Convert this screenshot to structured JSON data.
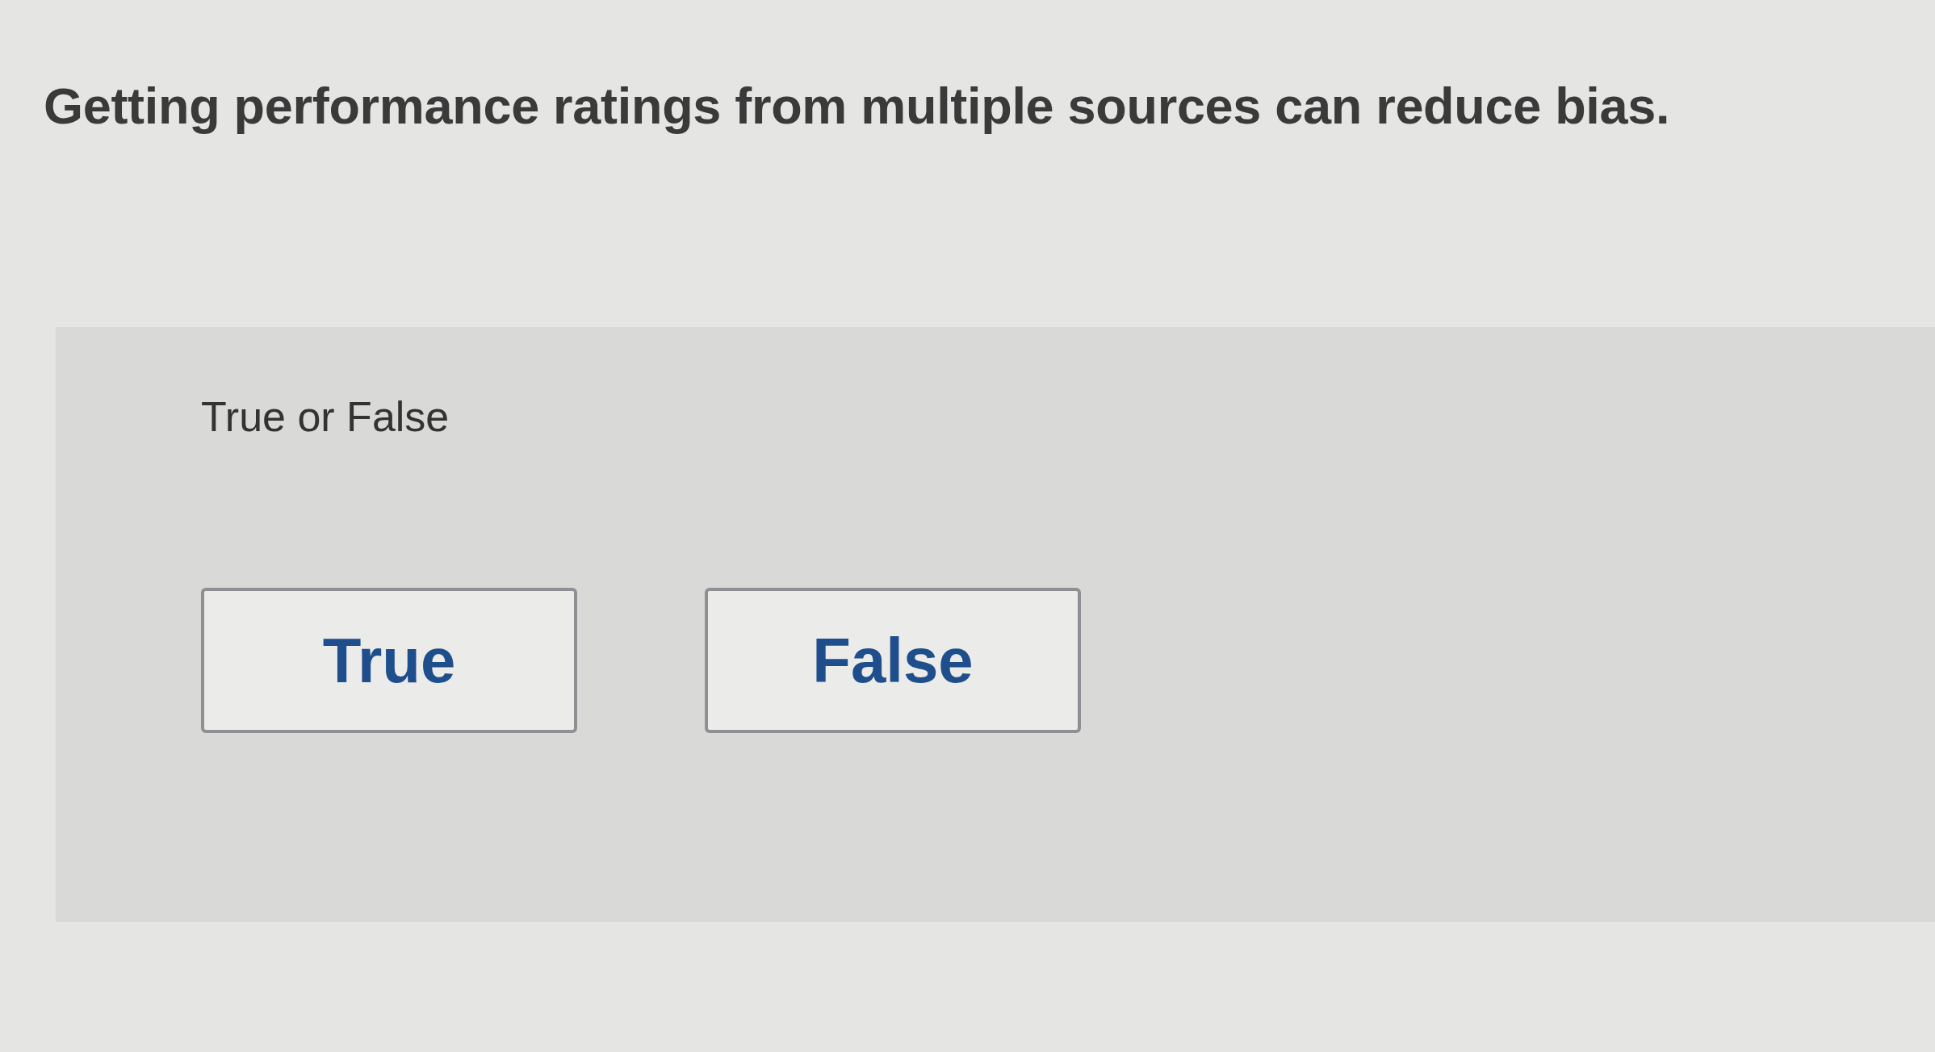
{
  "question": "Getting performance ratings from multiple sources can reduce bias.",
  "prompt": "True or False",
  "options": [
    {
      "label": "True",
      "selected": false
    },
    {
      "label": "False",
      "selected": false
    }
  ]
}
